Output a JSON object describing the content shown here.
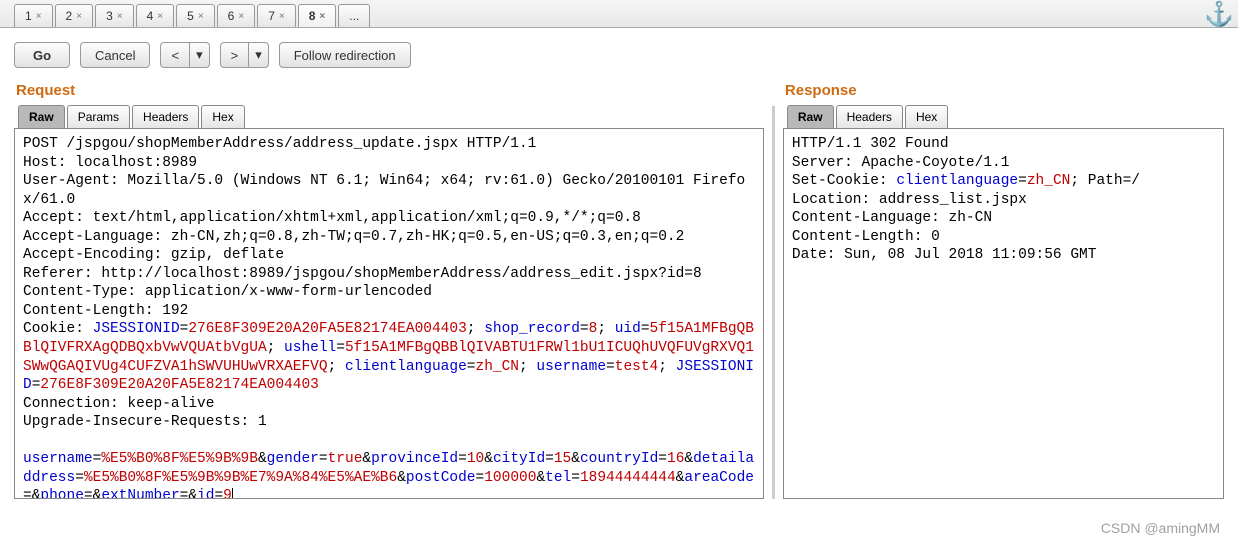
{
  "topTabs": {
    "items": [
      "1",
      "2",
      "3",
      "4",
      "5",
      "6",
      "7",
      "8"
    ],
    "activeIndex": 7,
    "more": "..."
  },
  "toolbar": {
    "go": "Go",
    "cancel": "Cancel",
    "prev": "<",
    "next": ">",
    "drop": "▾",
    "follow": "Follow redirection"
  },
  "request": {
    "title": "Request",
    "tabs": {
      "raw": "Raw",
      "params": "Params",
      "headers": "Headers",
      "hex": "Hex"
    },
    "lines": {
      "reqline": "POST /jspgou/shopMemberAddress/address_update.jspx HTTP/1.1",
      "host": "Host: localhost:8989",
      "ua": "User-Agent: Mozilla/5.0 (Windows NT 6.1; Win64; x64; rv:61.0) Gecko/20100101 Firefox/61.0",
      "accept": "Accept: text/html,application/xhtml+xml,application/xml;q=0.9,*/*;q=0.8",
      "acclang": "Accept-Language: zh-CN,zh;q=0.8,zh-TW;q=0.7,zh-HK;q=0.5,en-US;q=0.3,en;q=0.2",
      "accenc": "Accept-Encoding: gzip, deflate",
      "referer": "Referer: http://localhost:8989/jspgou/shopMemberAddress/address_edit.jspx?id=8",
      "ctype": "Content-Type: application/x-www-form-urlencoded",
      "clen": "Content-Length: 192",
      "cookie_label": "Cookie: ",
      "cookie_parts": [
        {
          "k": "JSESSIONID",
          "v": "276E8F309E20A20FA5E82174EA004403"
        },
        {
          "k": "shop_record",
          "v": "8"
        },
        {
          "k": "uid",
          "v": "5f15A1MFBgQBBlQIVFRXAgQDBQxbVwVQUAtbVgUA"
        },
        {
          "k": "ushell",
          "v": "5f15A1MFBgQBBlQIVABTU1FRWl1bU1ICUQhUVQFUVgRXVQ1SWwQGAQIVUg4CUFZVA1hSWVUHUwVRXAEFVQ"
        },
        {
          "k": "clientlanguage",
          "v": "zh_CN"
        },
        {
          "k": "username",
          "v": "test4"
        },
        {
          "k": "JSESSIONID",
          "v": "276E8F309E20A20FA5E82174EA004403"
        }
      ],
      "conn": "Connection: keep-alive",
      "upgrade": "Upgrade-Insecure-Requests: 1",
      "body_parts": [
        {
          "k": "username",
          "v": "%E5%B0%8F%E5%9B%9B"
        },
        {
          "k": "gender",
          "v": "true"
        },
        {
          "k": "provinceId",
          "v": "10"
        },
        {
          "k": "cityId",
          "v": "15"
        },
        {
          "k": "countryId",
          "v": "16"
        },
        {
          "k": "detailaddress",
          "v": "%E5%B0%8F%E5%9B%9B%E7%9A%84%E5%AE%B6"
        },
        {
          "k": "postCode",
          "v": "100000"
        },
        {
          "k": "tel",
          "v": "18944444444"
        },
        {
          "k": "areaCode",
          "v": ""
        },
        {
          "k": "phone",
          "v": ""
        },
        {
          "k": "extNumber",
          "v": ""
        },
        {
          "k": "id",
          "v": "9"
        }
      ]
    }
  },
  "response": {
    "title": "Response",
    "tabs": {
      "raw": "Raw",
      "headers": "Headers",
      "hex": "Hex"
    },
    "lines": {
      "status": "HTTP/1.1 302 Found",
      "server": "Server: Apache-Coyote/1.1",
      "setcookie_label": "Set-Cookie: ",
      "setcookie_k": "clientlanguage",
      "setcookie_v": "zh_CN",
      "setcookie_tail": "; Path=/",
      "location": "Location: address_list.jspx",
      "clang": "Content-Language: zh-CN",
      "clen": "Content-Length: 0",
      "date": "Date: Sun, 08 Jul 2018 11:09:56 GMT"
    }
  },
  "watermark": "CSDN @amingMM"
}
